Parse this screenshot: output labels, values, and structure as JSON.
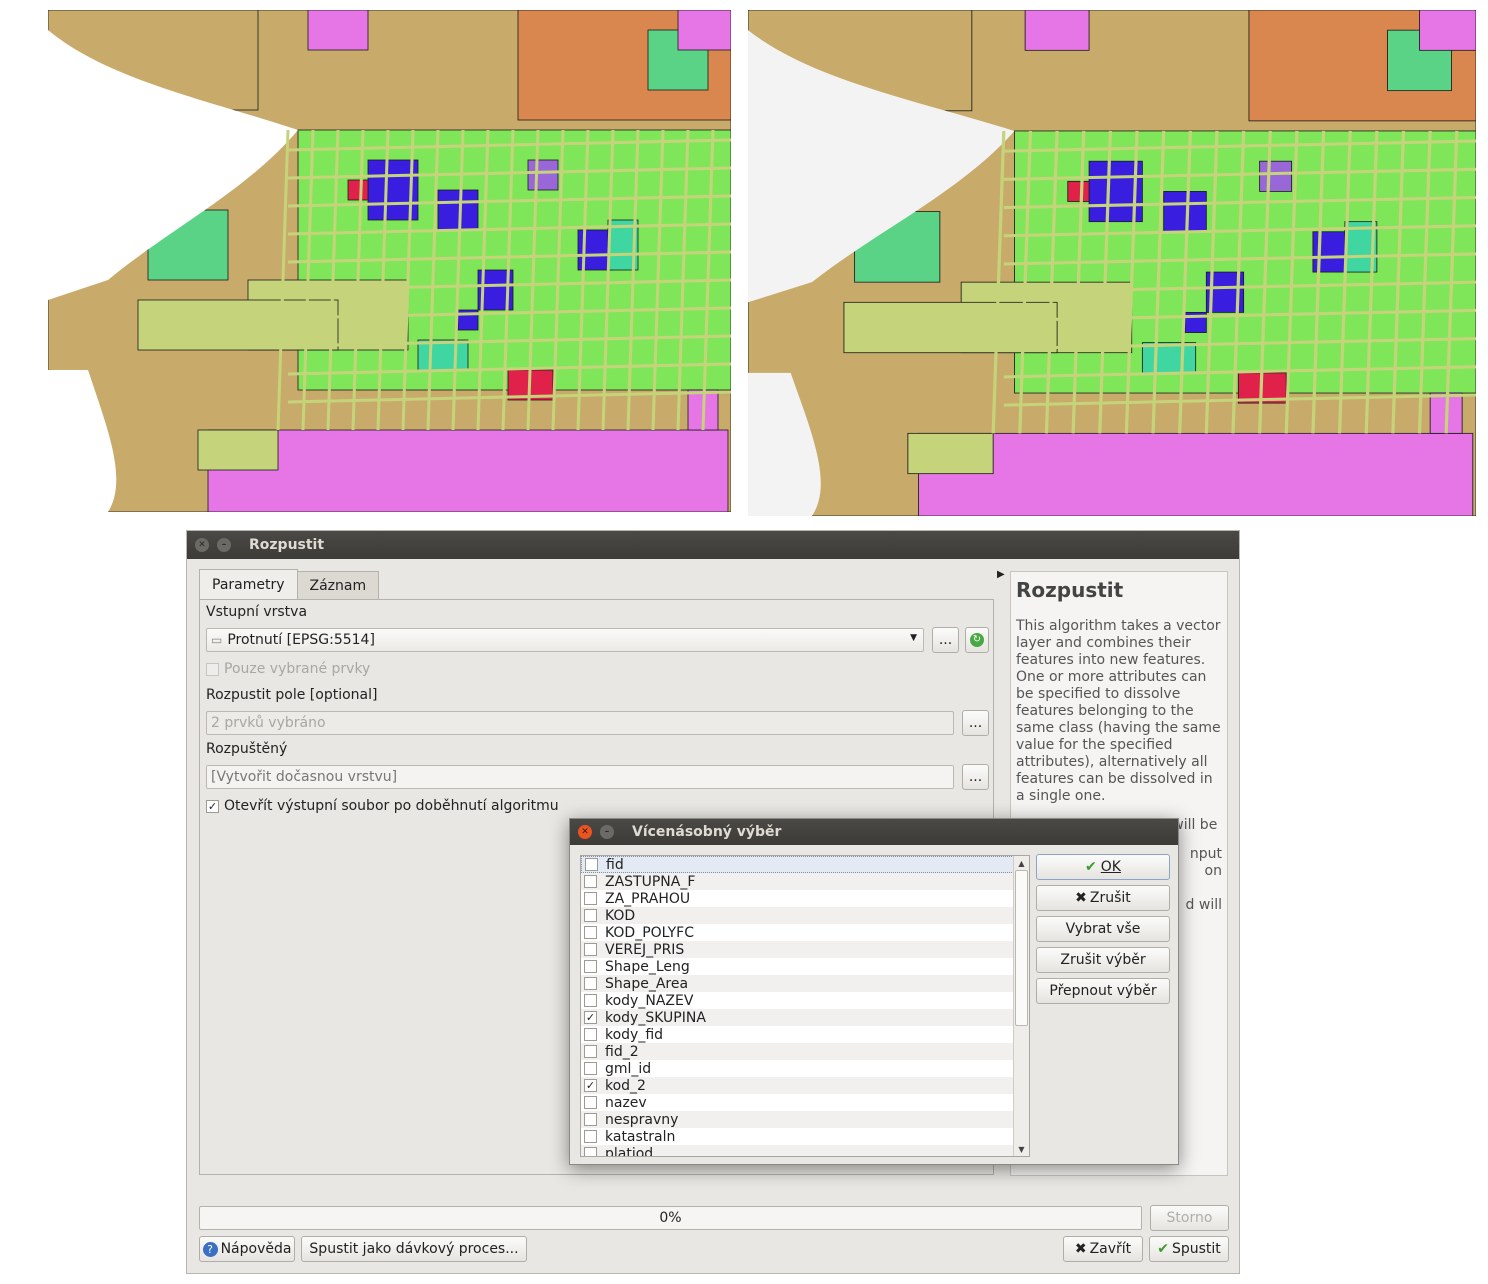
{
  "main_window": {
    "title": "Rozpustit",
    "tabs": [
      {
        "label": "Parametry",
        "active": true
      },
      {
        "label": "Záznam",
        "active": false
      }
    ],
    "params": {
      "input_layer_label": "Vstupní vrstva",
      "input_layer_value": "Protnutí [EPSG:5514]",
      "selected_only_label": "Pouze vybrané prvky",
      "dissolve_field_label": "Rozpustit pole [optional]",
      "dissolve_field_value": "2 prvků vybráno",
      "output_label": "Rozpuštěný",
      "output_placeholder": "[Vytvořit dočasnou vrstvu]",
      "open_output_label": "Otevřít výstupní soubor po doběhnutí algoritmu",
      "browse_label": "...",
      "checkmark": "✓"
    },
    "help": {
      "title": "Rozpustit",
      "paragraph1": "This algorithm takes a vector layer and combines their features into new features. One or more attributes can be specified to dissolve features belonging to the same class (having the same value for the specified attributes), alternatively all features can be dissolved in a single one.",
      "paragraph2": "All output geometries will be",
      "fragment_1": "nput",
      "fragment_2": "on",
      "fragment_3": "d will"
    },
    "progress": {
      "value": 0,
      "text": "0%"
    },
    "buttons": {
      "cancel": "Storno",
      "help": "Nápověda",
      "batch": "Spustit jako dávkový proces...",
      "close": "Zavřít",
      "run": "Spustit"
    }
  },
  "modal": {
    "title": "Vícenásobný výběr",
    "items": [
      {
        "label": "fid",
        "checked": false
      },
      {
        "label": "ZASTUPNA_F",
        "checked": false
      },
      {
        "label": "ZA_PRAHOU",
        "checked": false
      },
      {
        "label": "KOD",
        "checked": false
      },
      {
        "label": "KOD_POLYFC",
        "checked": false
      },
      {
        "label": "VEREJ_PRIS",
        "checked": false
      },
      {
        "label": "Shape_Leng",
        "checked": false
      },
      {
        "label": "Shape_Area",
        "checked": false
      },
      {
        "label": "kody_NAZEV",
        "checked": false
      },
      {
        "label": "kody_SKUPINA",
        "checked": true
      },
      {
        "label": "kody_fid",
        "checked": false
      },
      {
        "label": "fid_2",
        "checked": false
      },
      {
        "label": "gml_id",
        "checked": false
      },
      {
        "label": "kod_2",
        "checked": true
      },
      {
        "label": "nazev",
        "checked": false
      },
      {
        "label": "nespravny",
        "checked": false
      },
      {
        "label": "katastraln",
        "checked": false
      },
      {
        "label": "platiod",
        "checked": false
      }
    ],
    "buttons": {
      "ok": "OK",
      "cancel": "Zrušit",
      "select_all": "Vybrat vše",
      "clear_selection": "Zrušit výběr",
      "toggle_selection": "Přepnout výběr"
    }
  },
  "colors": {
    "map_tan": "#c8ab6a",
    "map_green": "#7fe65a",
    "map_olive": "#c5d47a",
    "map_blue": "#3a1ee0",
    "map_pink": "#e675e6",
    "map_orange": "#d9874f",
    "map_teal": "#3fd6a2",
    "map_red": "#e0224a",
    "map_purple": "#9a67d8",
    "map_mint": "#5bd386"
  }
}
